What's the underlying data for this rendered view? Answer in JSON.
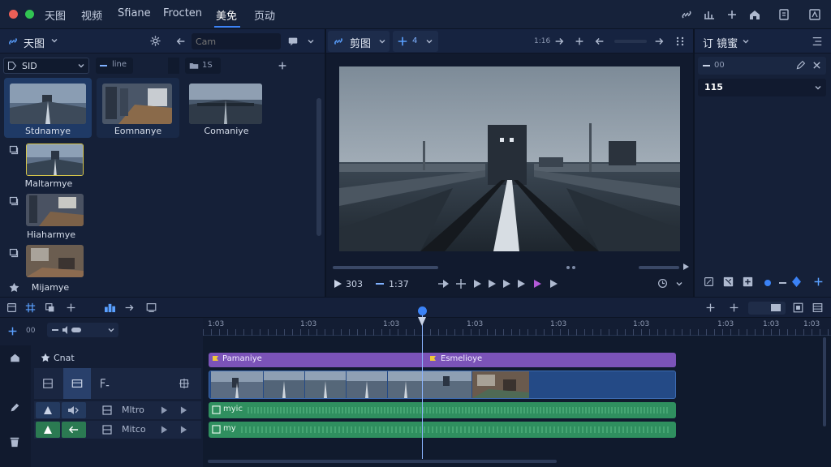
{
  "top_menu": {
    "items": [
      "天图",
      "视频",
      "Sfiane",
      "Frocten",
      "美免",
      "页动"
    ],
    "active_index": 4
  },
  "media_panel": {
    "title": "天图",
    "search_placeholder": "Cam",
    "filter_select": "SID",
    "tab_line": "line",
    "folder_label": "1S",
    "items": [
      {
        "label": "Stdnamye"
      },
      {
        "label": "Eomnanye"
      },
      {
        "label": "Comaniye"
      },
      {
        "label": "Maltarmye"
      },
      {
        "label": "Hiaharmye"
      },
      {
        "label": "Mijamye"
      }
    ]
  },
  "viewer": {
    "title": "剪图",
    "zoom_label": "4",
    "speed_label": "1:16",
    "time_current": "303",
    "time_total": "1:37"
  },
  "inspector": {
    "title": "订 镜蜜",
    "field_label": "00",
    "value": "115"
  },
  "timeline": {
    "counter": "00",
    "ruler_labels": [
      "1:03",
      "1:03",
      "1:03",
      "1:03",
      "1:03",
      "1:03",
      "1:03",
      "1:03",
      "1:03"
    ],
    "track_label": "Cnat",
    "clips": {
      "title_left": "Pamaniye",
      "title_right": "Esmelioye",
      "audio1": "myic",
      "audio2": "my"
    },
    "audio_track_1": "Mltro",
    "audio_track_2": "Mitco"
  },
  "colors": {
    "accent": "#3b82f6",
    "purple_clip": "#7b53b8",
    "green_clip": "#2f8f5f",
    "video_clip": "#244a86"
  }
}
